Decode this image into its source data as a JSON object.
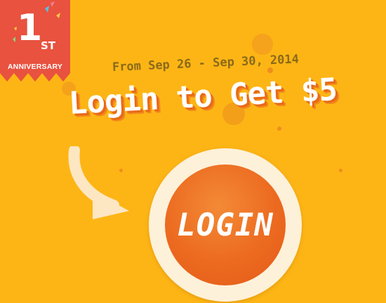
{
  "ribbon": {
    "number": "1",
    "suffix": "ST",
    "label": "ANNIVERSARY",
    "color": "#e8523f"
  },
  "promo": {
    "date_range": "From Sep 26 - Sep 30, 2014",
    "headline": "Login to Get $5"
  },
  "cta": {
    "label": "LOGIN",
    "color": "#ec6a20"
  },
  "icons": {
    "arrow": "curved-arrow-icon"
  },
  "colors": {
    "background": "#fdb515",
    "headline_shadow": "#e86a17",
    "date_text": "#8a6a1a"
  }
}
